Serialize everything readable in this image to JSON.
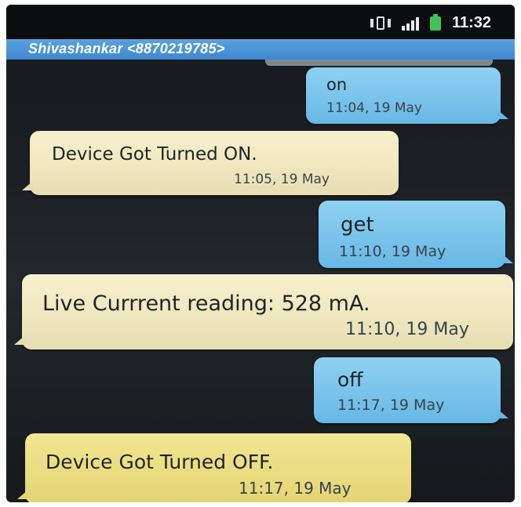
{
  "status_bar": {
    "time": "11:32",
    "icons": [
      "vibrate-icon",
      "signal-icon",
      "battery-icon"
    ],
    "battery_color": "#46c25a"
  },
  "thread": {
    "contact": "Shivashankar <8870219785>"
  },
  "messages": [
    {
      "direction": "sent",
      "text": "on",
      "time": "11:04, 19 May"
    },
    {
      "direction": "received",
      "text": "Device Got Turned ON.",
      "time": "11:05, 19 May"
    },
    {
      "direction": "sent",
      "text": "get",
      "time": "11:10, 19 May"
    },
    {
      "direction": "received",
      "text": "Live Currrent reading: 528 mA.",
      "time": "11:10, 19 May"
    },
    {
      "direction": "sent",
      "text": "off",
      "time": "11:17, 19 May"
    },
    {
      "direction": "received",
      "text": "Device Got Turned OFF.",
      "time": "11:17, 19 May"
    }
  ],
  "colors": {
    "sent_bubble": "#7fc6ee",
    "received_bubble": "#f0e9c2",
    "title_bar": "#4a93d6"
  }
}
